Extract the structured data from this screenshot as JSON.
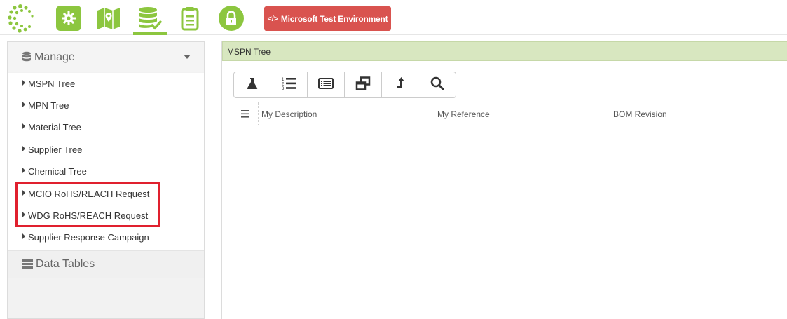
{
  "topbar": {
    "nav_icons": [
      "settings-gear-icon",
      "map-icon",
      "database-check-icon",
      "clipboard-icon",
      "lock-icon"
    ],
    "active_icon": "database-check-icon",
    "env_badge": {
      "icon": "</>",
      "label": "Microsoft Test Environment"
    }
  },
  "sidebar": {
    "manage_label": "Manage",
    "items": [
      {
        "label": "MSPN Tree"
      },
      {
        "label": "MPN Tree"
      },
      {
        "label": "Material Tree"
      },
      {
        "label": "Supplier Tree"
      },
      {
        "label": "Chemical Tree"
      },
      {
        "label": "MCIO RoHS/REACH Request"
      },
      {
        "label": "WDG RoHS/REACH Request"
      },
      {
        "label": "Supplier Response Campaign"
      }
    ],
    "data_tables_label": "Data Tables"
  },
  "main": {
    "title": "MSPN Tree",
    "toolbar_icons": [
      "flask-icon",
      "numbered-list-icon",
      "list-view-icon",
      "windows-restore-icon",
      "level-up-icon",
      "search-icon"
    ],
    "columns": [
      "My Description",
      "My Reference",
      "BOM Revision"
    ]
  },
  "colors": {
    "brand_green": "#8cc63f",
    "env_red": "#d9534f",
    "header_green": "#d8e7c0",
    "highlight_red": "#e0202e"
  }
}
